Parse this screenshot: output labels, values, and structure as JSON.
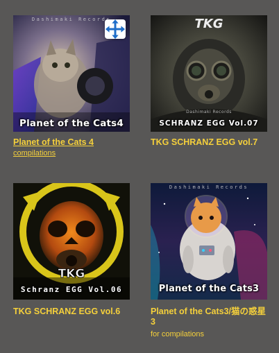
{
  "cards": [
    {
      "title": "Planet of the Cats 4",
      "subtitle": "compilations",
      "cover_brand": "Dashimaki Records",
      "cover_text": "Planet of the Cats4",
      "move_icon": "move-icon"
    },
    {
      "title": "TKG SCHRANZ EGG vol.7",
      "cover_logo": "TKG",
      "cover_brand": "Dashimaki Records",
      "cover_text": "SCHRANZ EGG Vol.07"
    },
    {
      "title": "TKG SCHRANZ EGG vol.6",
      "cover_logo": "TKG",
      "cover_text": "Schranz EGG Vol.06"
    },
    {
      "title": "Planet of the Cats3/猫の惑星3",
      "subtitle": "for compilations",
      "cover_brand": "Dashimaki Records",
      "cover_text": "Planet of the Cats3"
    }
  ],
  "colors": {
    "background": "#585756",
    "title": "#f5d03b"
  }
}
